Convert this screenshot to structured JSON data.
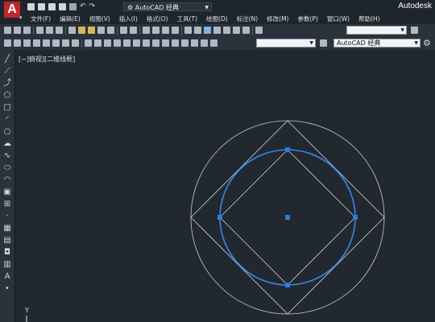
{
  "app": {
    "brand": "Autodesk",
    "logo_letter": "A",
    "workspace": "AutoCAD 经典"
  },
  "menu": [
    "文件(F)",
    "编辑(E)",
    "视图(V)",
    "插入(I)",
    "格式(O)",
    "工具(T)",
    "绘图(D)",
    "标注(N)",
    "修改(M)",
    "参数(P)",
    "窗口(W)",
    "帮助(H)"
  ],
  "toolbar": {
    "style_combo": "AutoCAD 经典",
    "layer_combo": ""
  },
  "viewport": {
    "label": "[−]俯视][二维线框]",
    "ucs_label": "Y"
  },
  "colors": {
    "background": "#212830",
    "selected_circle": "#3a86e8",
    "grip": "#2f7ce0",
    "line": "#c8ccd0"
  },
  "icons": [
    "app-menu-icon",
    "new-icon",
    "open-icon",
    "save-icon",
    "saveas-icon",
    "print-icon",
    "undo-icon",
    "redo-icon",
    "gear-icon"
  ]
}
